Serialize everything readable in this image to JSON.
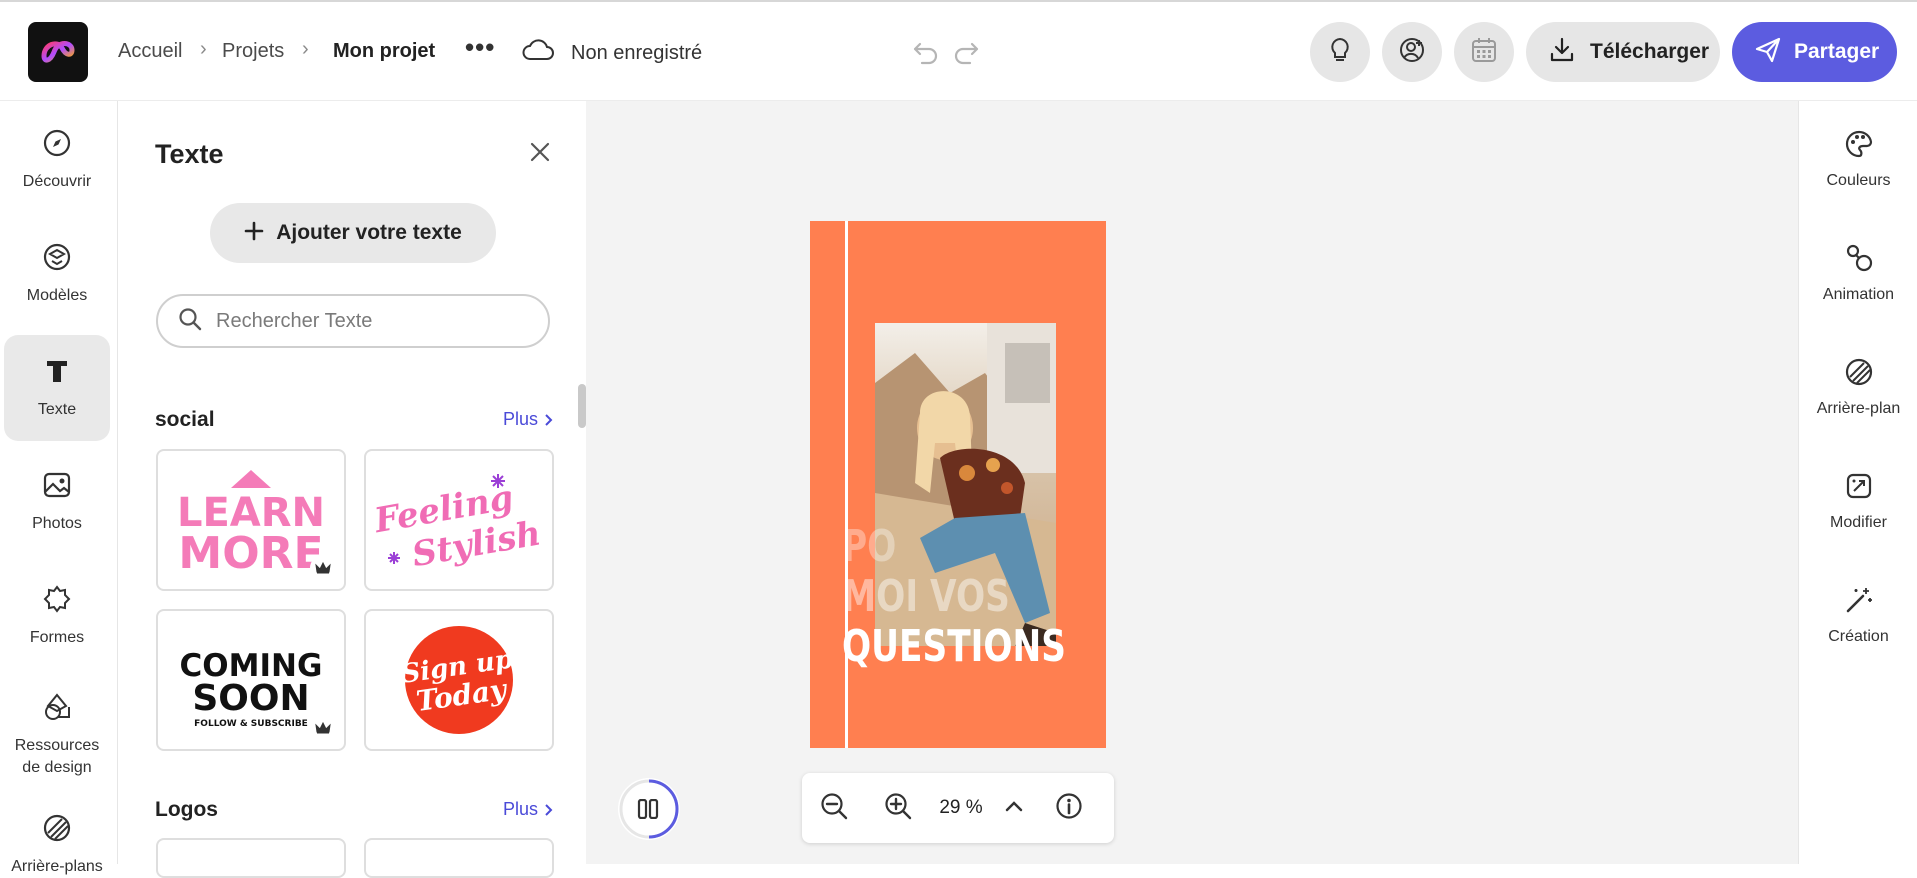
{
  "header": {
    "breadcrumbs": [
      "Accueil",
      "Projets",
      "Mon projet"
    ],
    "save_status": "Non enregistré",
    "download_label": "Télécharger",
    "share_label": "Partager"
  },
  "left_rail": {
    "items": [
      {
        "label": "Découvrir",
        "icon": "compass-icon"
      },
      {
        "label": "Modèles",
        "icon": "templates-icon"
      },
      {
        "label": "Texte",
        "icon": "text-icon",
        "active": true
      },
      {
        "label": "Photos",
        "icon": "photo-icon"
      },
      {
        "label": "Formes",
        "icon": "shapes-icon"
      },
      {
        "label": "Ressources de design",
        "icon": "design-assets-icon"
      },
      {
        "label": "Arrière-plans",
        "icon": "backgrounds-icon"
      }
    ]
  },
  "text_panel": {
    "title": "Texte",
    "add_button": "Ajouter votre texte",
    "search_placeholder": "Rechercher Texte",
    "sections": [
      {
        "title": "social",
        "more": "Plus"
      },
      {
        "title": "Logos",
        "more": "Plus"
      }
    ],
    "cards": [
      {
        "line1": "LEARN",
        "line2": "MORE",
        "premium": true
      },
      {
        "line1": "Feeling",
        "line2": "Stylish",
        "premium": false
      },
      {
        "line1": "COMING",
        "line2": "SOON",
        "line3": "FOLLOW & SUBSCRIBE",
        "premium": true
      },
      {
        "line1": "Sign up",
        "line2": "Today",
        "premium": false
      }
    ]
  },
  "canvas": {
    "art_lines": [
      "PO",
      "MOI VOS",
      "QUESTIONS"
    ],
    "zoom": "29 %"
  },
  "right_rail": {
    "items": [
      {
        "label": "Couleurs",
        "icon": "palette-icon"
      },
      {
        "label": "Animation",
        "icon": "animation-icon"
      },
      {
        "label": "Arrière-plan",
        "icon": "background-icon"
      },
      {
        "label": "Modifier",
        "icon": "edit-icon"
      },
      {
        "label": "Création",
        "icon": "magic-wand-icon"
      }
    ]
  },
  "colors": {
    "accent": "#5c5ce0",
    "artboard": "#ff7f50",
    "canvas_bg": "#f3f3f3"
  }
}
